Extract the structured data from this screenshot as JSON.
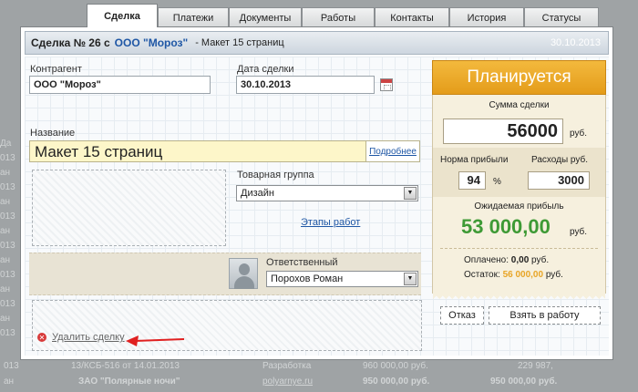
{
  "tabs": [
    "Сделка",
    "Платежи",
    "Документы",
    "Работы",
    "Контакты",
    "История",
    "Статусы"
  ],
  "header": {
    "title": "Сделка № 26 с",
    "client": "ООО \"Мороз\"",
    "subtitle": "- Макет 15 страниц",
    "date": "30.10.2013"
  },
  "form": {
    "counterparty_label": "Контрагент",
    "counterparty_value": "ООО \"Мороз\"",
    "date_label": "Дата сделки",
    "date_value": "30.10.2013",
    "name_label": "Название",
    "name_value": "Макет 15 страниц",
    "more_label": "Подробнее",
    "product_group_label": "Товарная группа",
    "product_group_value": "Дизайн",
    "stages_link": "Этапы работ",
    "responsible_label": "Ответственный",
    "responsible_value": "Порохов Роман",
    "delete_label": "Удалить сделку"
  },
  "panel": {
    "status": "Планируется",
    "sum_label": "Сумма сделки",
    "sum_value": "56000",
    "currency": "руб.",
    "margin_label": "Норма прибыли",
    "margin_value": "94",
    "percent": "%",
    "expenses_label": "Расходы руб.",
    "expenses_value": "3000",
    "expected_label": "Ожидаемая прибыль",
    "expected_value": "53 000,00",
    "paid_label": "Оплачено:",
    "paid_value": "0,00",
    "remaining_label": "Остаток:",
    "remaining_value": "56 000,00",
    "status_color": "#e8a526",
    "profit_color": "#3e9a35"
  },
  "buttons": {
    "refuse": "Отказ",
    "take": "Взять в работу"
  },
  "background": {
    "row_left_labels": [
      "Да",
      "013",
      "ан",
      "013",
      "ан",
      "013",
      "ан",
      "013",
      "ан",
      "013",
      "ан",
      "013",
      "ан",
      "013"
    ],
    "bottom_row1": [
      "013",
      "13/КСБ-516 от 14.01.2013",
      "Разработка",
      "960 000,00 руб.",
      "229 987,"
    ],
    "bottom_row2": [
      "ан",
      "ЗАО \"Полярные ночи\"",
      "polyarnye.ru",
      "950 000,00 руб.",
      "950 000,00 руб."
    ]
  }
}
